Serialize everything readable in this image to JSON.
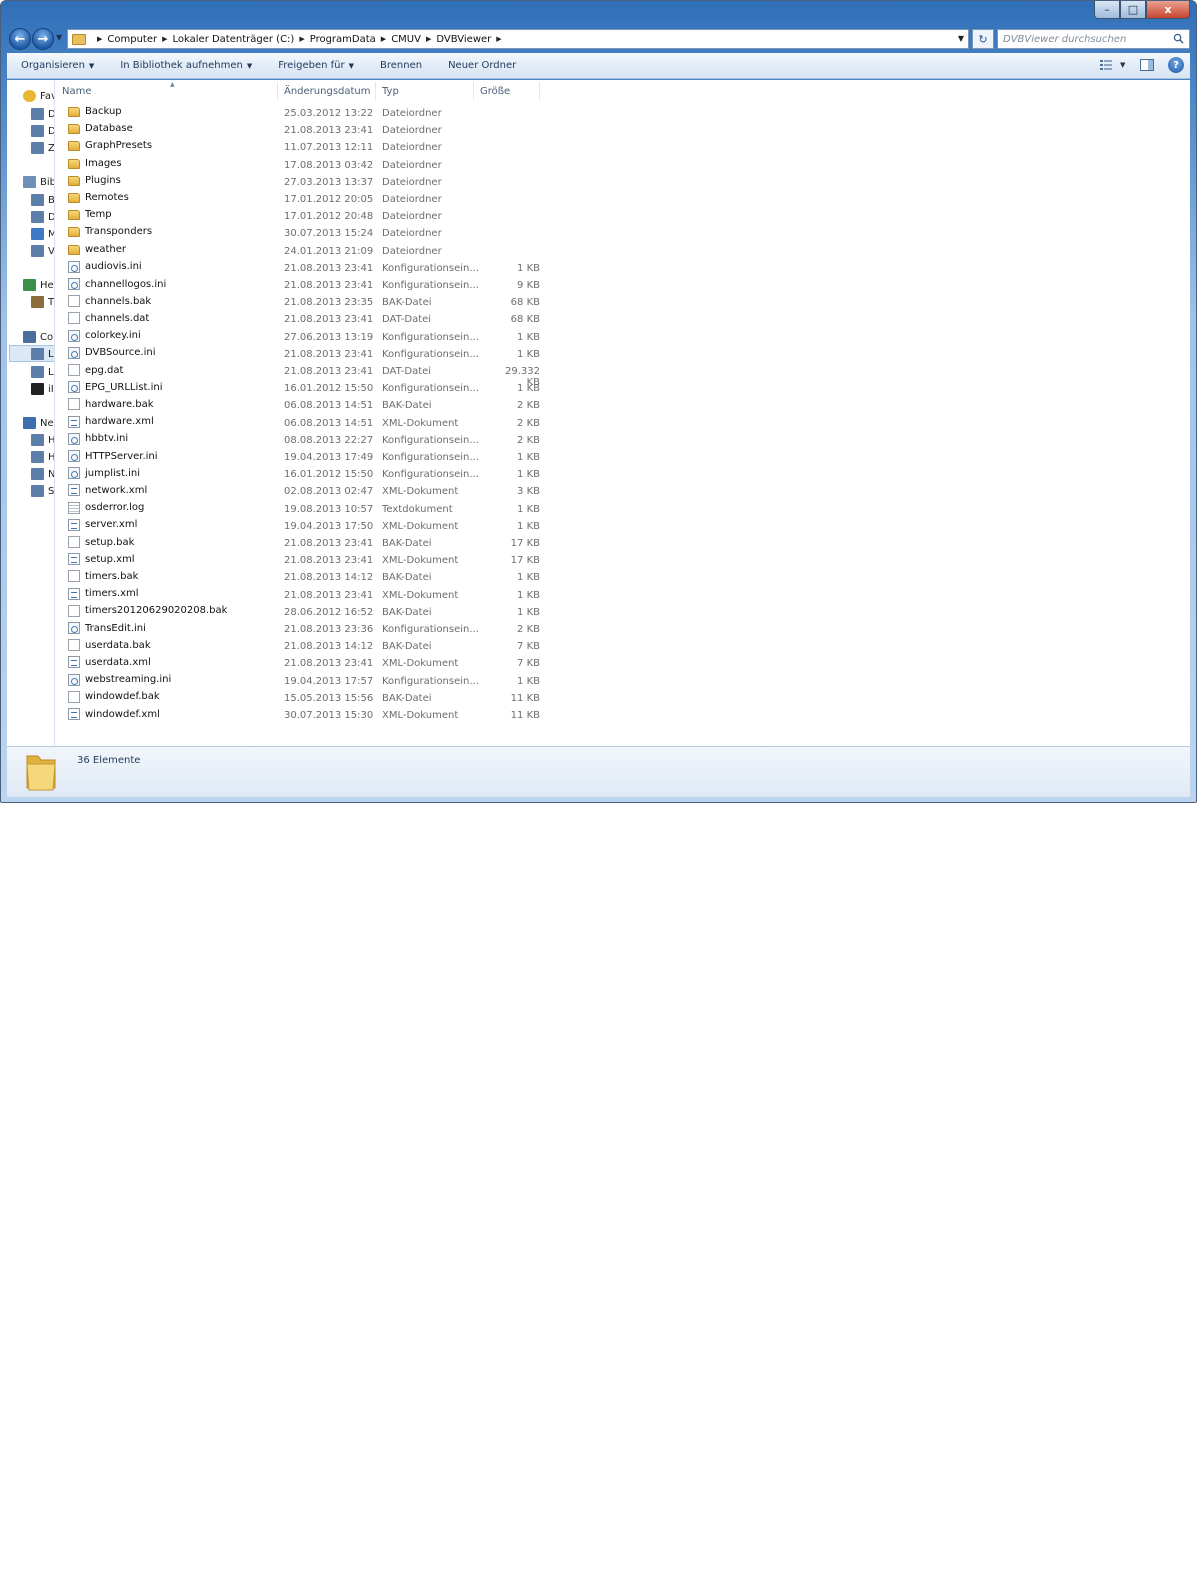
{
  "window": {
    "caption_buttons": {
      "minimize": "–",
      "maximize": "□",
      "close": "x"
    }
  },
  "navbar": {
    "back_glyph": "←",
    "forward_glyph": "→",
    "breadcrumbs": [
      "Computer",
      "Lokaler Datenträger (C:)",
      "ProgramData",
      "CMUV",
      "DVBViewer"
    ],
    "search_placeholder": "DVBViewer durchsuchen",
    "refresh_glyph": "↻"
  },
  "toolbar": {
    "organize": "Organisieren",
    "include_library": "In Bibliothek aufnehmen",
    "share": "Freigeben für",
    "burn": "Brennen",
    "new_folder": "Neuer Ordner",
    "help_glyph": "?"
  },
  "navpane": {
    "items": [
      {
        "label": "Fav",
        "icon": "star-icon"
      },
      {
        "label": "D",
        "icon": "desktop-icon"
      },
      {
        "label": "D",
        "icon": "downloads-icon"
      },
      {
        "label": "Z",
        "icon": "recent-places-icon"
      },
      {
        "label": "Bib",
        "icon": "libraries-icon"
      },
      {
        "label": "B",
        "icon": "pictures-icon"
      },
      {
        "label": "D",
        "icon": "documents-icon"
      },
      {
        "label": "M",
        "icon": "music-icon"
      },
      {
        "label": "V",
        "icon": "videos-icon"
      },
      {
        "label": "He",
        "icon": "homegroup-icon"
      },
      {
        "label": "T",
        "icon": "user-icon"
      },
      {
        "label": "Co",
        "icon": "computer-icon"
      },
      {
        "label": "L",
        "icon": "local-disk-icon"
      },
      {
        "label": "L",
        "icon": "drive-icon"
      },
      {
        "label": "iI",
        "icon": "device-icon"
      },
      {
        "label": "Ne",
        "icon": "network-icon"
      },
      {
        "label": "H",
        "icon": "network-pc-icon"
      },
      {
        "label": "H",
        "icon": "network-pc-icon"
      },
      {
        "label": "N",
        "icon": "network-pc-icon"
      },
      {
        "label": "S",
        "icon": "network-pc-icon"
      }
    ]
  },
  "columns": {
    "name": "Name",
    "date": "Änderungsdatum",
    "type": "Typ",
    "size": "Größe"
  },
  "files": [
    {
      "name": "Backup",
      "date": "25.03.2012 13:22",
      "type": "Dateiordner",
      "size": "",
      "icon": "folder-icon"
    },
    {
      "name": "Database",
      "date": "21.08.2013 23:41",
      "type": "Dateiordner",
      "size": "",
      "icon": "folder-icon"
    },
    {
      "name": "GraphPresets",
      "date": "11.07.2013 12:11",
      "type": "Dateiordner",
      "size": "",
      "icon": "folder-icon"
    },
    {
      "name": "Images",
      "date": "17.08.2013 03:42",
      "type": "Dateiordner",
      "size": "",
      "icon": "folder-icon"
    },
    {
      "name": "Plugins",
      "date": "27.03.2013 13:37",
      "type": "Dateiordner",
      "size": "",
      "icon": "folder-icon"
    },
    {
      "name": "Remotes",
      "date": "17.01.2012 20:05",
      "type": "Dateiordner",
      "size": "",
      "icon": "folder-icon"
    },
    {
      "name": "Temp",
      "date": "17.01.2012 20:48",
      "type": "Dateiordner",
      "size": "",
      "icon": "folder-icon"
    },
    {
      "name": "Transponders",
      "date": "30.07.2013 15:24",
      "type": "Dateiordner",
      "size": "",
      "icon": "folder-icon"
    },
    {
      "name": "weather",
      "date": "24.01.2013 21:09",
      "type": "Dateiordner",
      "size": "",
      "icon": "folder-icon"
    },
    {
      "name": "audiovis.ini",
      "date": "21.08.2013 23:41",
      "type": "Konfigurationsein...",
      "size": "1 KB",
      "icon": "ini-file-icon"
    },
    {
      "name": "channellogos.ini",
      "date": "21.08.2013 23:41",
      "type": "Konfigurationsein...",
      "size": "9 KB",
      "icon": "ini-file-icon"
    },
    {
      "name": "channels.bak",
      "date": "21.08.2013 23:35",
      "type": "BAK-Datei",
      "size": "68 KB",
      "icon": "generic-file-icon"
    },
    {
      "name": "channels.dat",
      "date": "21.08.2013 23:41",
      "type": "DAT-Datei",
      "size": "68 KB",
      "icon": "generic-file-icon"
    },
    {
      "name": "colorkey.ini",
      "date": "27.06.2013 13:19",
      "type": "Konfigurationsein...",
      "size": "1 KB",
      "icon": "ini-file-icon"
    },
    {
      "name": "DVBSource.ini",
      "date": "21.08.2013 23:41",
      "type": "Konfigurationsein...",
      "size": "1 KB",
      "icon": "ini-file-icon"
    },
    {
      "name": "epg.dat",
      "date": "21.08.2013 23:41",
      "type": "DAT-Datei",
      "size": "29.332 KB",
      "icon": "generic-file-icon"
    },
    {
      "name": "EPG_URLList.ini",
      "date": "16.01.2012 15:50",
      "type": "Konfigurationsein...",
      "size": "1 KB",
      "icon": "ini-file-icon"
    },
    {
      "name": "hardware.bak",
      "date": "06.08.2013 14:51",
      "type": "BAK-Datei",
      "size": "2 KB",
      "icon": "generic-file-icon"
    },
    {
      "name": "hardware.xml",
      "date": "06.08.2013 14:51",
      "type": "XML-Dokument",
      "size": "2 KB",
      "icon": "xml-file-icon"
    },
    {
      "name": "hbbtv.ini",
      "date": "08.08.2013 22:27",
      "type": "Konfigurationsein...",
      "size": "2 KB",
      "icon": "ini-file-icon"
    },
    {
      "name": "HTTPServer.ini",
      "date": "19.04.2013 17:49",
      "type": "Konfigurationsein...",
      "size": "1 KB",
      "icon": "ini-file-icon"
    },
    {
      "name": "jumplist.ini",
      "date": "16.01.2012 15:50",
      "type": "Konfigurationsein...",
      "size": "1 KB",
      "icon": "ini-file-icon"
    },
    {
      "name": "network.xml",
      "date": "02.08.2013 02:47",
      "type": "XML-Dokument",
      "size": "3 KB",
      "icon": "xml-file-icon"
    },
    {
      "name": "osderror.log",
      "date": "19.08.2013 10:57",
      "type": "Textdokument",
      "size": "1 KB",
      "icon": "text-file-icon"
    },
    {
      "name": "server.xml",
      "date": "19.04.2013 17:50",
      "type": "XML-Dokument",
      "size": "1 KB",
      "icon": "xml-file-icon"
    },
    {
      "name": "setup.bak",
      "date": "21.08.2013 23:41",
      "type": "BAK-Datei",
      "size": "17 KB",
      "icon": "generic-file-icon"
    },
    {
      "name": "setup.xml",
      "date": "21.08.2013 23:41",
      "type": "XML-Dokument",
      "size": "17 KB",
      "icon": "xml-file-icon"
    },
    {
      "name": "timers.bak",
      "date": "21.08.2013 14:12",
      "type": "BAK-Datei",
      "size": "1 KB",
      "icon": "generic-file-icon"
    },
    {
      "name": "timers.xml",
      "date": "21.08.2013 23:41",
      "type": "XML-Dokument",
      "size": "1 KB",
      "icon": "xml-file-icon"
    },
    {
      "name": "timers20120629020208.bak",
      "date": "28.06.2012 16:52",
      "type": "BAK-Datei",
      "size": "1 KB",
      "icon": "generic-file-icon"
    },
    {
      "name": "TransEdit.ini",
      "date": "21.08.2013 23:36",
      "type": "Konfigurationsein...",
      "size": "2 KB",
      "icon": "ini-file-icon"
    },
    {
      "name": "userdata.bak",
      "date": "21.08.2013 14:12",
      "type": "BAK-Datei",
      "size": "7 KB",
      "icon": "generic-file-icon"
    },
    {
      "name": "userdata.xml",
      "date": "21.08.2013 23:41",
      "type": "XML-Dokument",
      "size": "7 KB",
      "icon": "xml-file-icon"
    },
    {
      "name": "webstreaming.ini",
      "date": "19.04.2013 17:57",
      "type": "Konfigurationsein...",
      "size": "1 KB",
      "icon": "ini-file-icon"
    },
    {
      "name": "windowdef.bak",
      "date": "15.05.2013 15:56",
      "type": "BAK-Datei",
      "size": "11 KB",
      "icon": "generic-file-icon"
    },
    {
      "name": "windowdef.xml",
      "date": "30.07.2013 15:30",
      "type": "XML-Dokument",
      "size": "11 KB",
      "icon": "xml-file-icon"
    }
  ],
  "status": {
    "count_text": "36 Elemente"
  },
  "colors": {
    "accent": "#1e395b",
    "muted_text": "#6d6d6d",
    "folder": "#e2b03c"
  }
}
